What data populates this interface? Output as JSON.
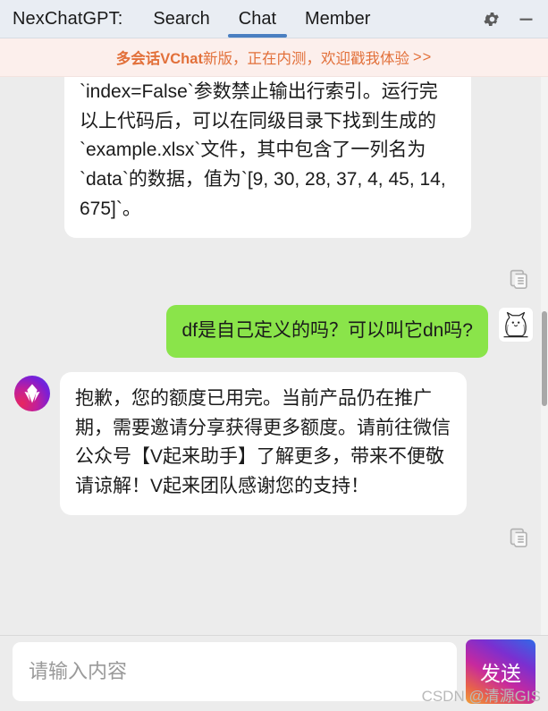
{
  "header": {
    "brand": "NexChatGPT:",
    "tabs": [
      {
        "label": "Search",
        "active": false
      },
      {
        "label": "Chat",
        "active": true
      },
      {
        "label": "Member",
        "active": false
      }
    ],
    "settings_icon": "gear-icon",
    "minimize_icon": "minimize-icon",
    "accent_color": "#4a7fc1",
    "background_color": "#e9edf3"
  },
  "banner": {
    "strong_text": "多会话VChat",
    "rest_text": " 新版，正在内测，欢迎戳我体验",
    "arrow": ">>",
    "text_color": "#e2703a",
    "background_color": "#fcefec"
  },
  "conversation": {
    "messages": [
      {
        "role": "bot",
        "clipped": true,
        "text": "入到Excel文件`example.xlsx`中，并通过`index=False`参数禁止输出行索引。运行完以上代码后，可以在同级目录下找到生成的`example.xlsx`文件，其中包含了一列名为`data`的数据，值为`[9, 30, 28, 37, 4, 45, 14, 675]`。",
        "copy_icon": "copy-icon",
        "bubble_color": "#ffffff"
      },
      {
        "role": "user",
        "text": "df是自己定义的吗？可以叫它dn吗?",
        "avatar": "cat-avatar",
        "bubble_color": "#8ae44a"
      },
      {
        "role": "bot",
        "text": "抱歉，您的额度已用完。当前产品仍在推广期，需要邀请分享获得更多额度。请前往微信公众号【V起来助手】了解更多，带来不便敬请谅解！V起来团队感谢您的支持！",
        "avatar": "v-logo-avatar",
        "copy_icon": "copy-icon",
        "bubble_color": "#ffffff"
      }
    ]
  },
  "composer": {
    "placeholder": "请输入内容",
    "value": "",
    "send_label": "发送"
  },
  "watermark": "CSDN @清源GIS"
}
